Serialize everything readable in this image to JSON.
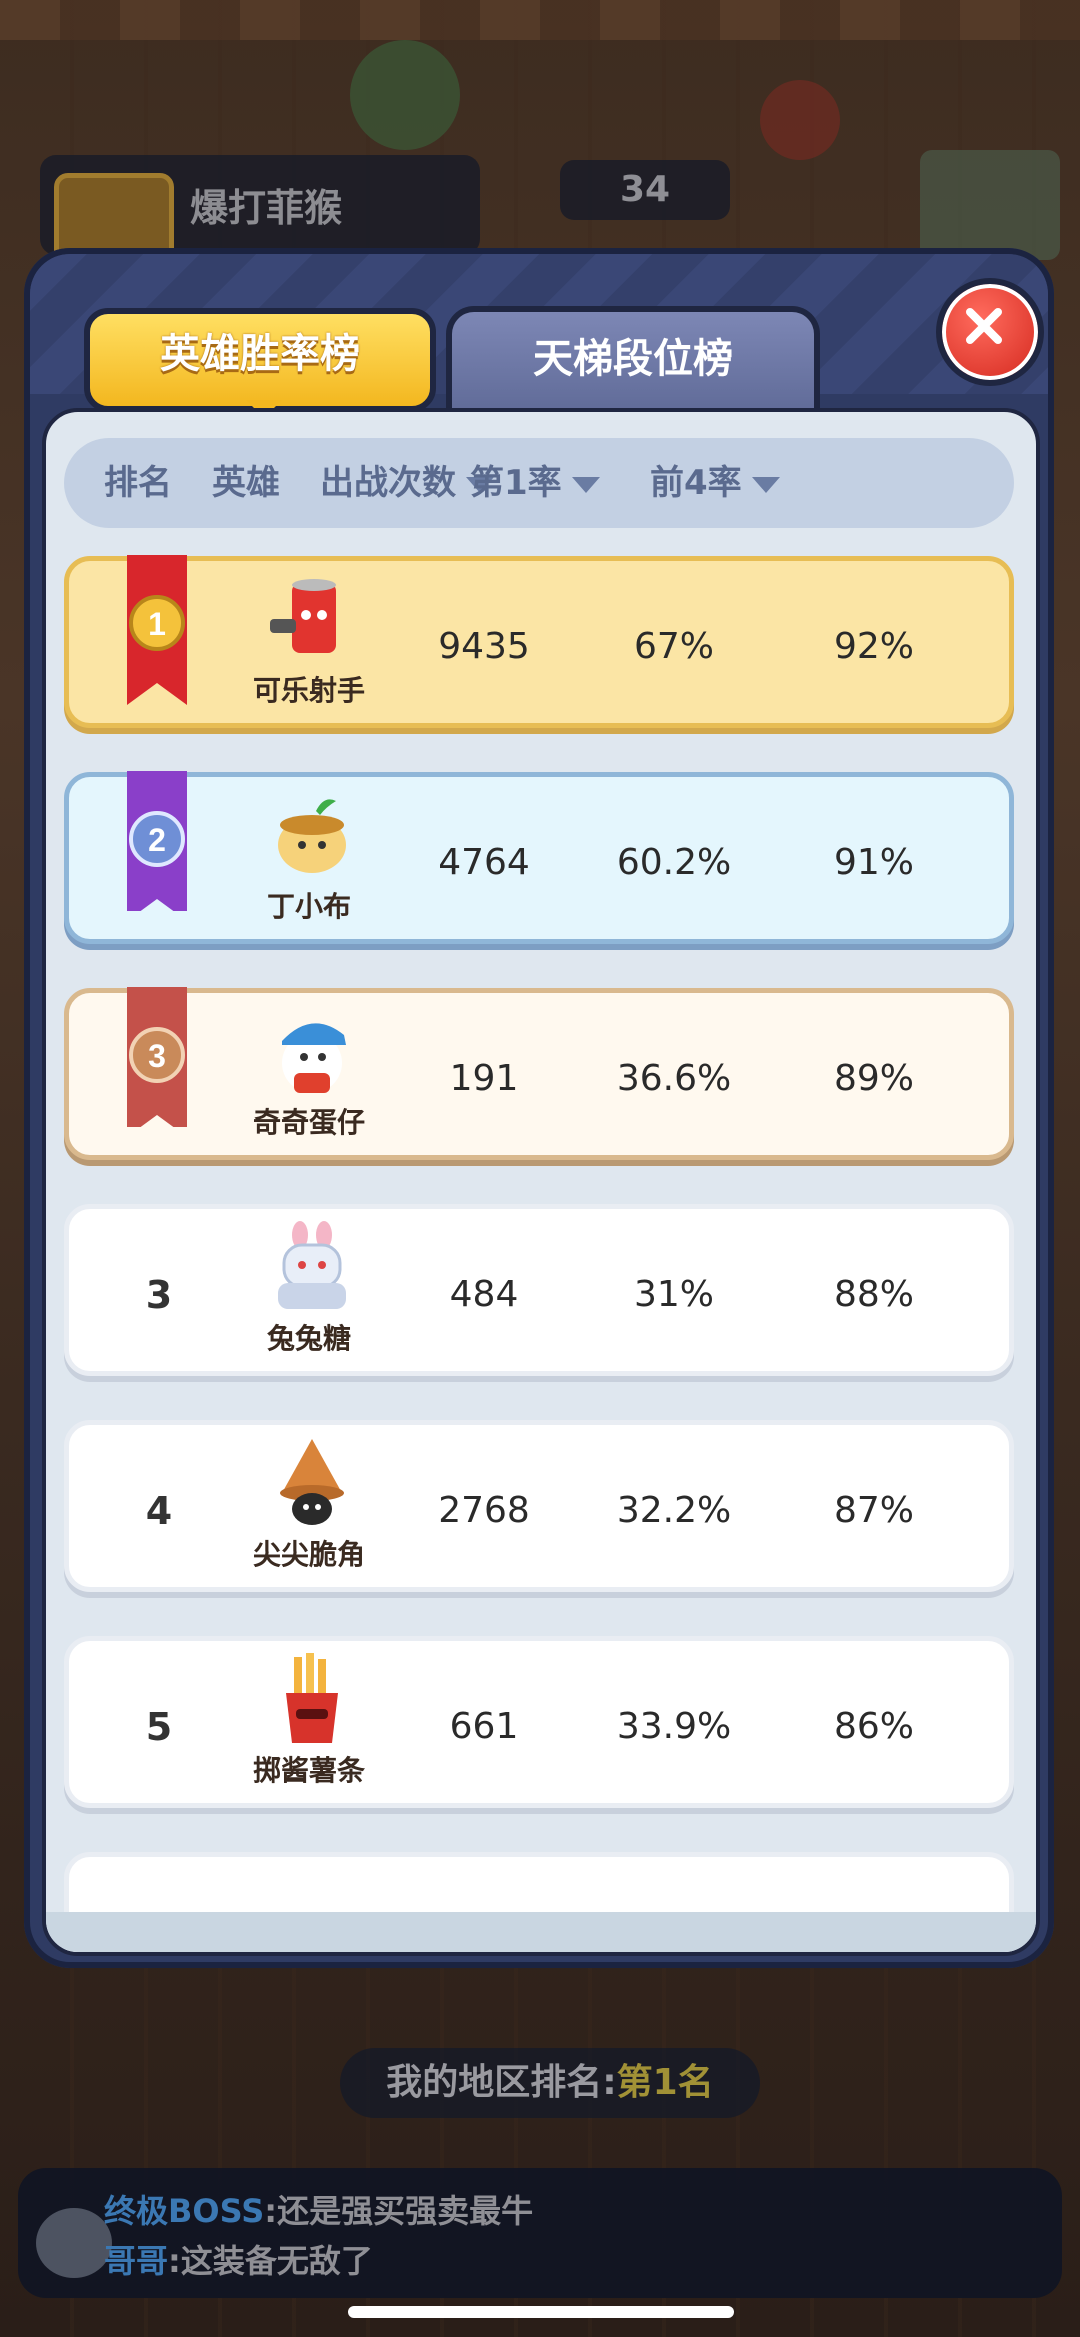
{
  "background": {
    "player_name": "爆打菲猴",
    "score": "34",
    "region_rank_label": "我的地区排名:",
    "region_rank_value": "第1名"
  },
  "chat": [
    {
      "who": "终极BOSS",
      "msg": ":还是强买强卖最牛"
    },
    {
      "who": "哥哥",
      "msg": ":这装备无敌了"
    }
  ],
  "tabs": {
    "active": "英雄胜率榜",
    "inactive": "天梯段位榜"
  },
  "columns": {
    "rank": "排名",
    "hero": "英雄",
    "games": "出战次数",
    "first_rate": "第1率",
    "top4_rate": "前4率"
  },
  "rows": [
    {
      "rank": "",
      "medal": "gold-medal-1",
      "hero": "可乐射手",
      "games": "9435",
      "first": "67%",
      "top4": "92%"
    },
    {
      "rank": "",
      "medal": "purple-medal-2",
      "hero": "丁小布",
      "games": "4764",
      "first": "60.2%",
      "top4": "91%"
    },
    {
      "rank": "",
      "medal": "bronze-medal-3",
      "hero": "奇奇蛋仔",
      "games": "191",
      "first": "36.6%",
      "top4": "89%"
    },
    {
      "rank": "3",
      "hero": "兔兔糖",
      "games": "484",
      "first": "31%",
      "top4": "88%"
    },
    {
      "rank": "4",
      "hero": "尖尖脆角",
      "games": "2768",
      "first": "32.2%",
      "top4": "87%"
    },
    {
      "rank": "5",
      "hero": "掷酱薯条",
      "games": "661",
      "first": "33.9%",
      "top4": "86%"
    }
  ],
  "colors": {
    "tab_active": "#f3b71f",
    "close_button": "#d3271d",
    "gold_row": "#fbe5a5",
    "blue_row": "#e4f6fd",
    "bronze_row": "#fff9ef"
  }
}
